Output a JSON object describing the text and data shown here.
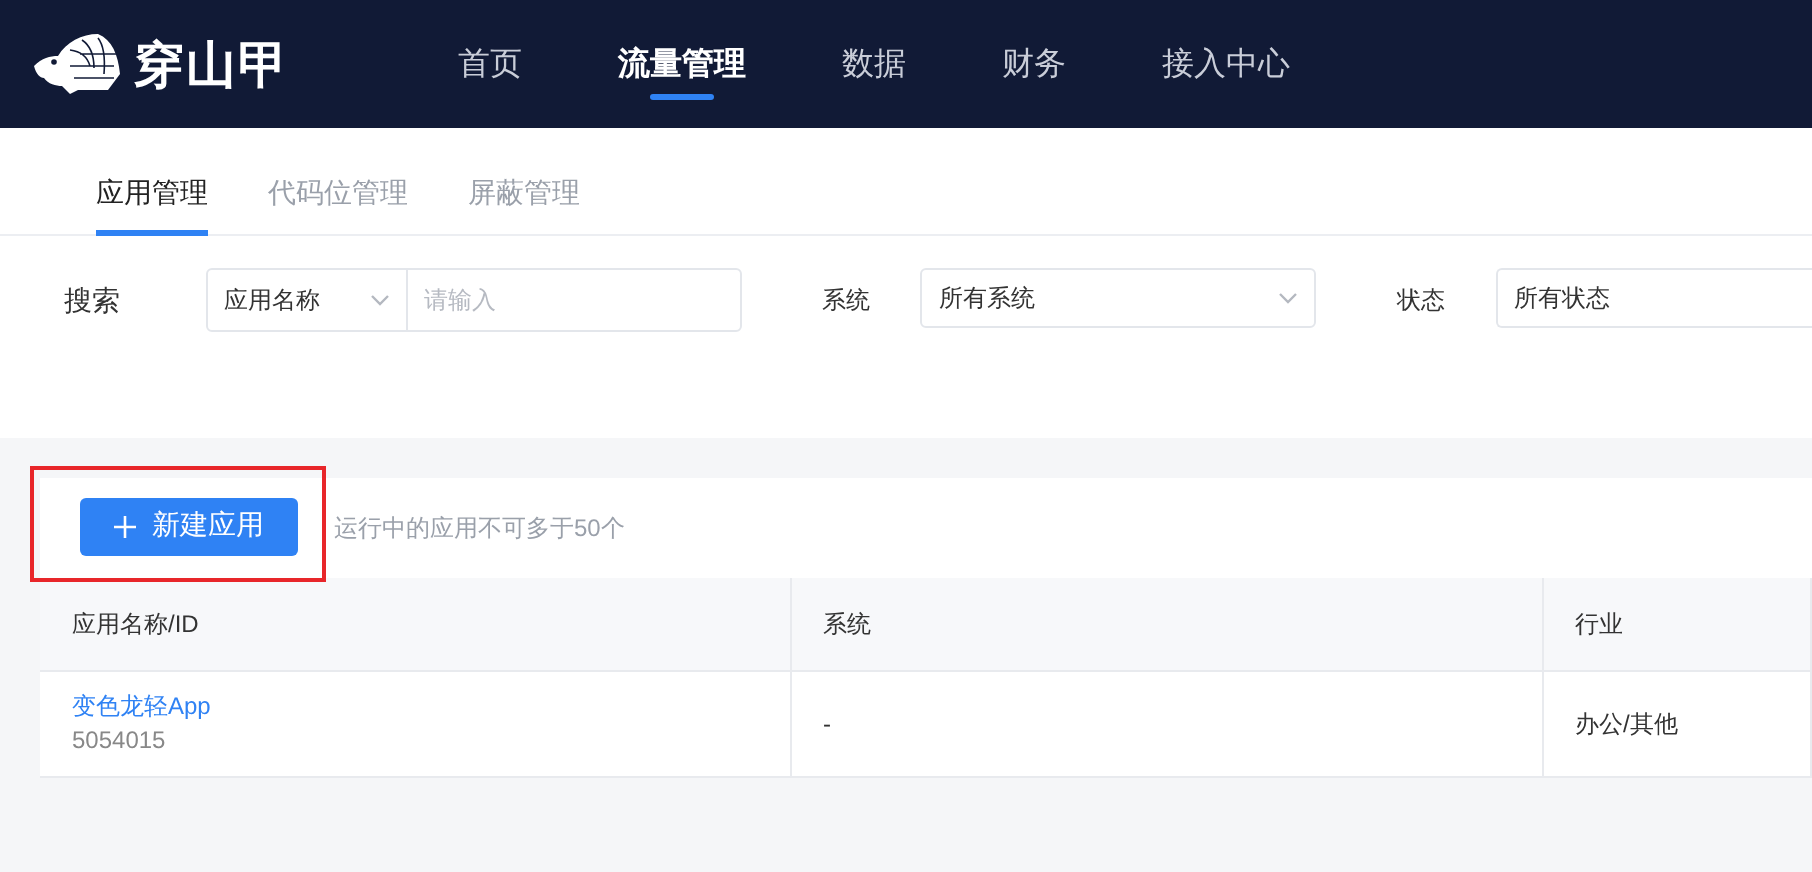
{
  "header": {
    "logo_text": "穿山甲",
    "nav": [
      {
        "label": "首页",
        "selected": false
      },
      {
        "label": "流量管理",
        "selected": true
      },
      {
        "label": "数据",
        "selected": false
      },
      {
        "label": "财务",
        "selected": false
      },
      {
        "label": "接入中心",
        "selected": false
      }
    ]
  },
  "tabs": [
    {
      "label": "应用管理",
      "selected": true
    },
    {
      "label": "代码位管理",
      "selected": false
    },
    {
      "label": "屏蔽管理",
      "selected": false
    }
  ],
  "filters": {
    "search_label": "搜索",
    "search_type": "应用名称",
    "search_placeholder": "请输入",
    "system_label": "系统",
    "system_value": "所有系统",
    "status_label": "状态",
    "status_value": "所有状态"
  },
  "actions": {
    "new_button": "新建应用",
    "highlighted": true,
    "hint": "运行中的应用不可多于50个"
  },
  "table": {
    "columns": [
      "应用名称/ID",
      "系统",
      "行业"
    ],
    "rows": [
      {
        "name": "变色龙轻App",
        "id": "5054015",
        "system": "-",
        "industry": "办公/其他"
      }
    ]
  }
}
